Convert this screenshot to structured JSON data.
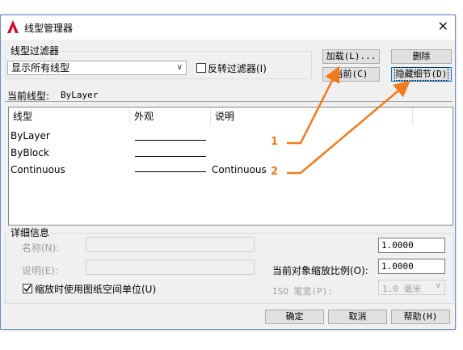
{
  "window": {
    "title": "线型管理器",
    "close_glyph": "✕"
  },
  "filter": {
    "group_label": "线型过滤器",
    "combo_value": "显示所有线型",
    "invert_label": "反转过滤器(I)",
    "invert_checked": false
  },
  "buttons": {
    "load": "加载(L)...",
    "delete": "删除",
    "current": "当前(C)",
    "hide_details": "隐藏细节(D)",
    "ok": "确定",
    "cancel": "取消",
    "help": "帮助(H)"
  },
  "current_linetype": {
    "label": "当前线型:",
    "value": "ByLayer"
  },
  "table": {
    "columns": [
      "线型",
      "外观",
      "说明"
    ],
    "rows": [
      {
        "name": "ByLayer",
        "appearance": "solid",
        "description": ""
      },
      {
        "name": "ByBlock",
        "appearance": "solid",
        "description": ""
      },
      {
        "name": "Continuous",
        "appearance": "solid",
        "description": "Continuous"
      }
    ]
  },
  "details": {
    "group_label": "详细信息",
    "name_label": "名称(N):",
    "desc_label": "说明(E):",
    "paper_space_label": "缩放时使用图纸空间单位(U)",
    "paper_space_checked": true,
    "global_scale_value": "1.0000",
    "current_scale_label": "当前对象缩放比例(O):",
    "current_scale_value": "1.0000",
    "iso_pen_label": "ISO 笔宽(P):",
    "iso_pen_value": "1.0 毫米"
  },
  "annotations": {
    "callout_1": "1",
    "callout_2": "2",
    "arrow_color": "#f07b1d"
  },
  "colors": {
    "accent": "#0078d7",
    "app_icon_red": "#c8102e"
  }
}
